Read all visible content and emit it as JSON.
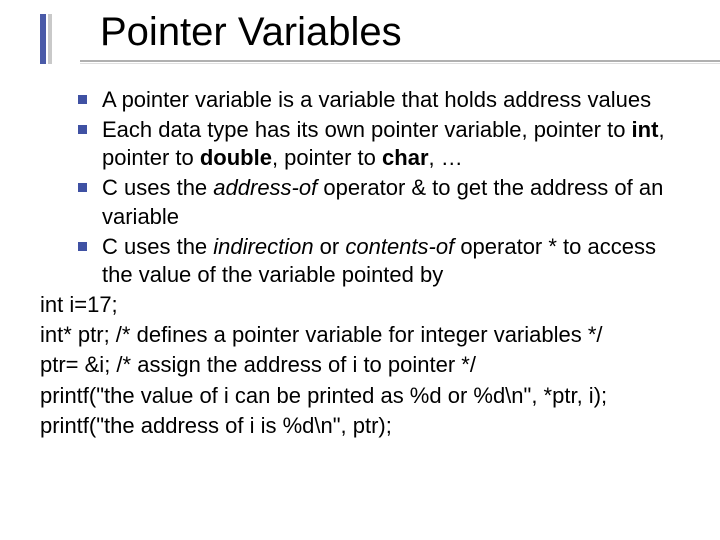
{
  "title": "Pointer Variables",
  "bullets": {
    "b1": "A pointer variable is a variable that holds address values",
    "b2_pre": "Each data type has its own pointer variable, pointer to ",
    "b2_bold1": "int",
    "b2_mid1": ", pointer to ",
    "b2_bold2": "double",
    "b2_mid2": ", pointer to ",
    "b2_bold3": "char",
    "b2_post": ", …",
    "b3_pre": "C uses the ",
    "b3_it": "address-of",
    "b3_post": " operator & to get the address of an variable",
    "b4_pre": "C  uses the ",
    "b4_it1": "indirection",
    "b4_mid": " or ",
    "b4_it2": "contents-of",
    "b4_post": "  operator * to access the value of the variable pointed by"
  },
  "code": {
    "l1": "int i=17;",
    "l2": "int* ptr;   /* defines a pointer variable for integer variables */",
    "l3": "ptr= &i;  /* assign the address of i to pointer */",
    "l4": "printf(\"the value of i can be printed as %d or %d\\n\", *ptr, i);",
    "l5": "printf(\"the address of i is %d\\n\", ptr);"
  }
}
